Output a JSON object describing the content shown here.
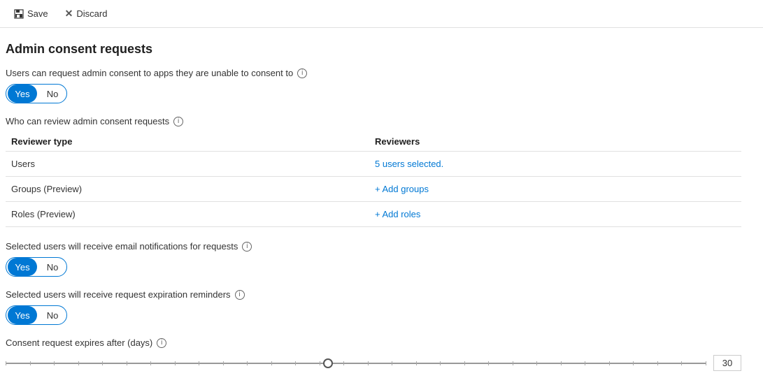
{
  "toolbar": {
    "save_label": "Save",
    "discard_label": "Discard"
  },
  "page": {
    "title": "Admin consent requests",
    "users_can_request_label": "Users can request admin consent to apps they are unable to consent to",
    "users_toggle": {
      "yes": "Yes",
      "no": "No",
      "active": "yes"
    },
    "who_can_review_label": "Who can review admin consent requests",
    "table": {
      "col1": "Reviewer type",
      "col2": "Reviewers",
      "rows": [
        {
          "type": "Users",
          "reviewer": "5 users selected.",
          "reviewer_type": "link"
        },
        {
          "type": "Groups (Preview)",
          "reviewer": "+ Add groups",
          "reviewer_type": "link"
        },
        {
          "type": "Roles (Preview)",
          "reviewer": "+ Add roles",
          "reviewer_type": "link"
        }
      ]
    },
    "email_notifications_label": "Selected users will receive email notifications for requests",
    "email_toggle": {
      "yes": "Yes",
      "no": "No",
      "active": "yes"
    },
    "expiration_reminders_label": "Selected users will receive request expiration reminders",
    "expiration_toggle": {
      "yes": "Yes",
      "no": "No",
      "active": "yes"
    },
    "expires_after_label": "Consent request expires after (days)",
    "slider": {
      "value": 30,
      "min": 1,
      "max": 365,
      "current_percent": 46
    }
  }
}
